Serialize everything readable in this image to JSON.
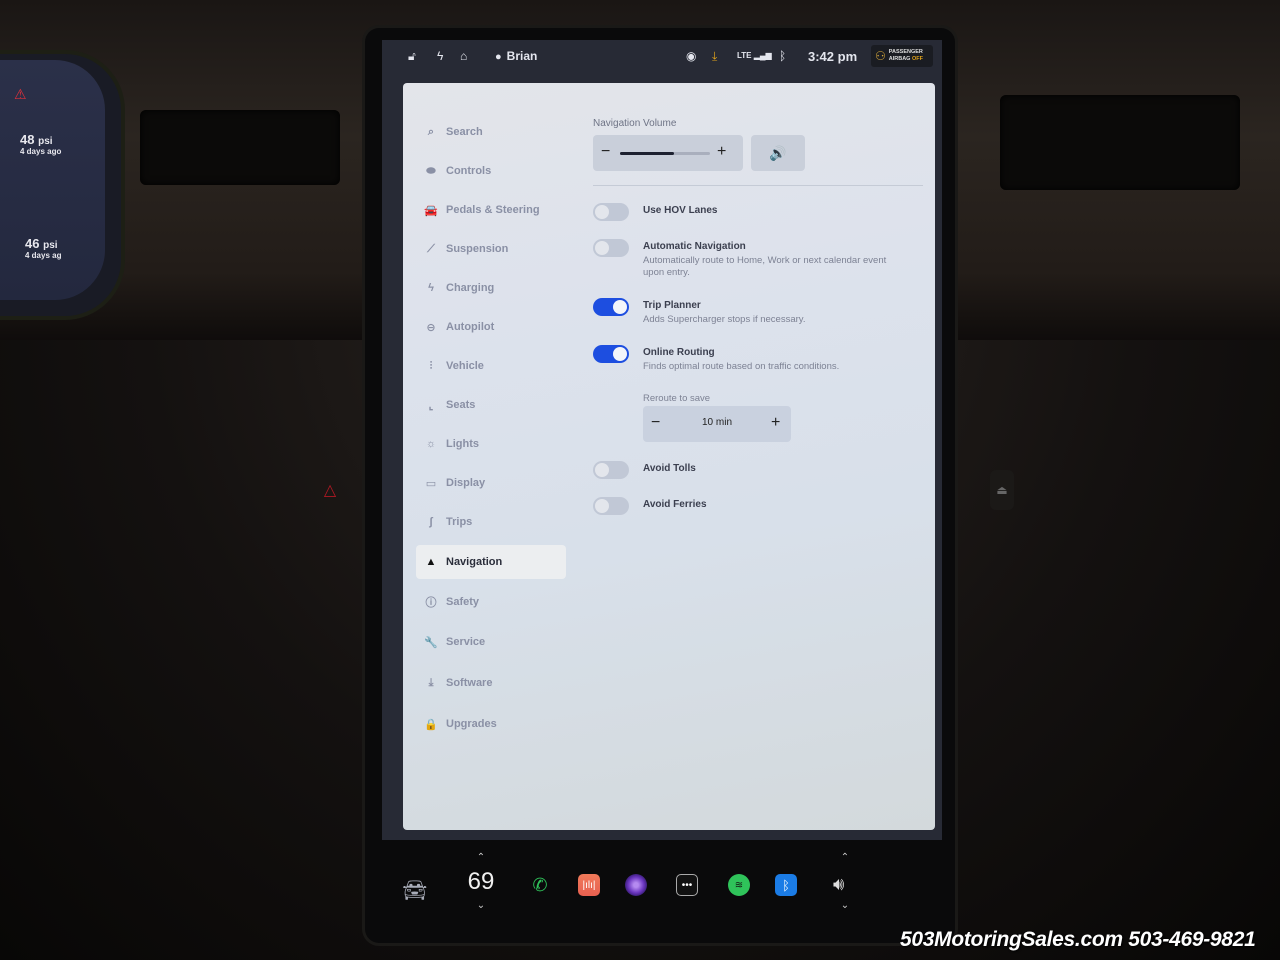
{
  "status_bar": {
    "icons": [
      "lock-icon",
      "bolt-icon",
      "homelink-icon"
    ],
    "user": "Brian",
    "right_icons": [
      "dashcam-icon",
      "download-icon",
      "lte-signal-icon",
      "bluetooth-icon"
    ],
    "lte_label": "LTE",
    "time": "3:42 pm",
    "airbag": {
      "line1": "PASSENGER",
      "line2_prefix": "AIRBAG",
      "line2_state": "OFF"
    }
  },
  "cluster": {
    "tires": [
      {
        "pressure": "48",
        "unit": "psi",
        "age": "4 days ago"
      },
      {
        "pressure": "46",
        "unit": "psi",
        "age": "4 days ag"
      }
    ]
  },
  "sidebar": {
    "items": [
      {
        "label": "Search",
        "icon": "search-icon",
        "glyph": "⌕"
      },
      {
        "label": "Controls",
        "icon": "toggle-icon",
        "glyph": "⬬"
      },
      {
        "label": "Pedals & Steering",
        "icon": "car-icon",
        "glyph": "🚘"
      },
      {
        "label": "Suspension",
        "icon": "suspension-icon",
        "glyph": "⟋"
      },
      {
        "label": "Charging",
        "icon": "bolt-icon",
        "glyph": "ϟ"
      },
      {
        "label": "Autopilot",
        "icon": "steering-wheel-icon",
        "glyph": "⊖"
      },
      {
        "label": "Vehicle",
        "icon": "sliders-icon",
        "glyph": "⫶"
      },
      {
        "label": "Seats",
        "icon": "seat-icon",
        "glyph": "⌞"
      },
      {
        "label": "Lights",
        "icon": "sun-icon",
        "glyph": "☼"
      },
      {
        "label": "Display",
        "icon": "display-icon",
        "glyph": "▭"
      },
      {
        "label": "Trips",
        "icon": "trips-icon",
        "glyph": "ʃ"
      },
      {
        "label": "Navigation",
        "icon": "navigation-arrow-icon",
        "glyph": "▲",
        "active": true
      },
      {
        "label": "Safety",
        "icon": "alert-circle-icon",
        "glyph": "ⓘ"
      },
      {
        "label": "Service",
        "icon": "wrench-icon",
        "glyph": "🔧"
      },
      {
        "label": "Software",
        "icon": "download-icon",
        "glyph": "⤓"
      },
      {
        "label": "Upgrades",
        "icon": "bag-icon",
        "glyph": "🔒"
      }
    ]
  },
  "navigation": {
    "volume": {
      "label": "Navigation Volume",
      "level_percent": 60,
      "minus": "−",
      "plus": "+",
      "speaker_glyph": "🔊"
    },
    "toggles": [
      {
        "title": "Use HOV Lanes",
        "description": "",
        "on": false
      },
      {
        "title": "Automatic Navigation",
        "description": "Automatically route to Home, Work or next calendar event upon entry.",
        "on": false
      },
      {
        "title": "Trip Planner",
        "description": "Adds Supercharger stops if necessary.",
        "on": true
      },
      {
        "title": "Online Routing",
        "description": "Finds optimal route based on traffic conditions.",
        "on": true
      },
      {
        "title": "Avoid Tolls",
        "description": "",
        "on": false
      },
      {
        "title": "Avoid Ferries",
        "description": "",
        "on": false
      }
    ],
    "reroute": {
      "label": "Reroute to save",
      "value": "10 min",
      "minus": "−",
      "plus": "+"
    }
  },
  "dock": {
    "temperature": "69",
    "up": "⌃",
    "down": "⌄",
    "apps": [
      "phone",
      "audio",
      "camera",
      "more",
      "spotify",
      "bluetooth"
    ]
  },
  "watermark": "503MotoringSales.com 503-469-9821"
}
